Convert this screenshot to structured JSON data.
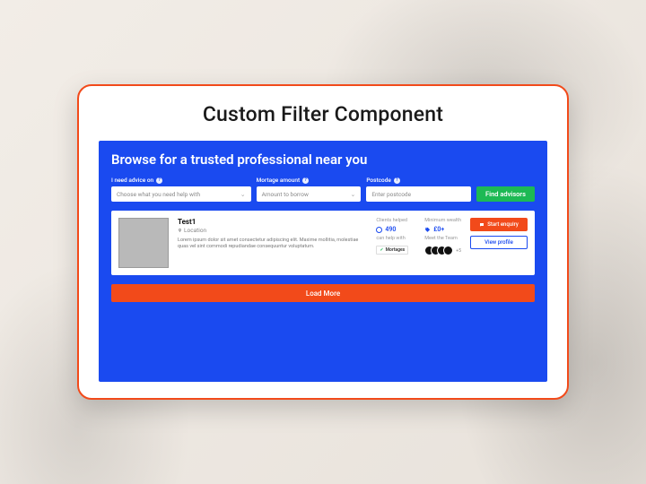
{
  "title": "Custom Filter Component",
  "panel": {
    "heading": "Browse for a trusted professional near you",
    "fields": {
      "advice": {
        "label": "I need advice on",
        "placeholder": "Choose what you need help with"
      },
      "amount": {
        "label": "Mortage amount",
        "placeholder": "Amount to borrow"
      },
      "postcode": {
        "label": "Postcode",
        "placeholder": "Enter postcode"
      }
    },
    "find_label": "Find advisors"
  },
  "result": {
    "name": "Test1",
    "location": "Location",
    "description": "Lorem ipsum dolor sit amet consectetur adipiscing elit. Maxime mollitia, molestiae quas vel sint commodi repudiandae consequuntur voluptatum.",
    "stats": {
      "clients_label": "Clients helped",
      "clients_value": "490",
      "wealth_label": "Minimum wealth",
      "wealth_value": "£0+",
      "help_label": "can help with",
      "tag": "Mortages",
      "team_label": "Meet the Team",
      "team_more": "+5"
    },
    "actions": {
      "enquiry": "Start enquiry",
      "profile": "View profile"
    }
  },
  "load_more": "Load More"
}
